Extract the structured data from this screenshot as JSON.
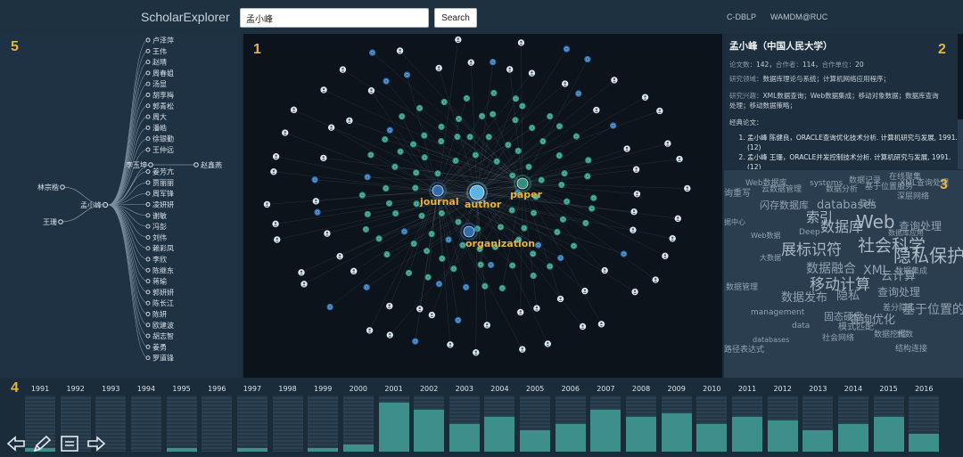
{
  "header": {
    "brand": "ScholarExplorer",
    "search_value": "孟小峰",
    "search_button": "Search",
    "links": [
      "C-DBLP",
      "WAMDM@RUC"
    ]
  },
  "panel_numbers": [
    "1",
    "2",
    "3",
    "4",
    "5"
  ],
  "tree": {
    "root": "孟小峰",
    "left_children": [
      "林宗楷",
      "王珊"
    ],
    "hub": "李玉坤",
    "hub_child": "赵鑫燕",
    "right_children": [
      "卢泽萍",
      "王伟",
      "赵晴",
      "周春姐",
      "汤显",
      "胡享梅",
      "郭青松",
      "周大",
      "潘皓",
      "徐银勤",
      "王仲远",
      "",
      "姜芳亢",
      "贾丽丽",
      "周军锋",
      "凌妍妍",
      "谢敏",
      "冯彭",
      "刘伟",
      "赖彩凤",
      "李欣",
      "陈继东",
      "蒋瑜",
      "郭妍妍",
      "陈长江",
      "陈妍",
      "欧建波",
      "胡志智",
      "姜勇",
      "罗道锋"
    ]
  },
  "graph": {
    "labels": {
      "journal": "journal",
      "author": "author",
      "paper": "paper",
      "organization": "organization"
    }
  },
  "info": {
    "name": "孟小峰（中国人民大学）",
    "stats_line_labels": [
      "论文数：",
      "合作者：",
      "合作单位："
    ],
    "stats_values": [
      "142",
      "114",
      "20"
    ],
    "field_label": "研究领域：",
    "field_value": "数据库理论与系统；计算机网络应用程序；",
    "interest_label": "研究兴趣：",
    "interest_value": "XML数据查询；Web数据集成；移动对象数据；数据库查询处理；移动数据策略；",
    "classic_label": "经典论文：",
    "papers": [
      "孟小峰 陈健良，ORACLE查询优化技术分析. 计算机研究与发展, 1991.(12)",
      "孟小峰 王珊，ORACLE并发控制技术分析. 计算机研究与发展, 1991.(12)"
    ]
  },
  "cloud_words": [
    "Web数据库",
    "systems",
    "数据记录",
    "在线聚集",
    "询重写",
    "深层网络",
    "闪存数据库",
    "databases",
    "隐私",
    "索引",
    "Web",
    "数据库",
    "查询处理",
    "数据库应用",
    "据中心",
    "Deep",
    "Web数据",
    "社会科学",
    "展标识符",
    "大数据",
    "隐私保护",
    "数据融合",
    "XML",
    "数据集成",
    "移动计算",
    "云计算",
    "数据管理",
    "数据发布",
    "查询处理",
    "隐私",
    "基于位置的服务",
    "差分隐私",
    "management",
    "固态硬盘",
    "查询优化",
    "数据挖掘",
    "代数",
    "模式匹配",
    "data",
    "社会网络",
    "databases",
    "路径表达式",
    "结构连接",
    "云数据管理",
    "数据分析",
    "基于位置服务",
    "XML查询处理"
  ],
  "timeline": {
    "years": [
      "1991",
      "1992",
      "1993",
      "1994",
      "1995",
      "1996",
      "1997",
      "1998",
      "1999",
      "2000",
      "2001",
      "2002",
      "2003",
      "2004",
      "2005",
      "2006",
      "2007",
      "2008",
      "2009",
      "2010",
      "2011",
      "2012",
      "2013",
      "2014",
      "2015",
      "2016"
    ],
    "values": [
      1,
      0,
      0,
      0,
      1,
      0,
      1,
      0,
      1,
      2,
      14,
      12,
      8,
      10,
      6,
      8,
      12,
      10,
      11,
      8,
      10,
      9,
      6,
      8,
      10,
      5
    ],
    "max": 16
  },
  "controls": [
    "back-arrow-icon",
    "pencil-icon",
    "notes-icon",
    "forward-arrow-icon"
  ],
  "colors": {
    "accent": "#e8b33a",
    "bar": "#3c8f8a",
    "teal_node": "#2e8f7e",
    "blue_node": "#2f6cb0",
    "white_node": "#dfe7ee"
  }
}
